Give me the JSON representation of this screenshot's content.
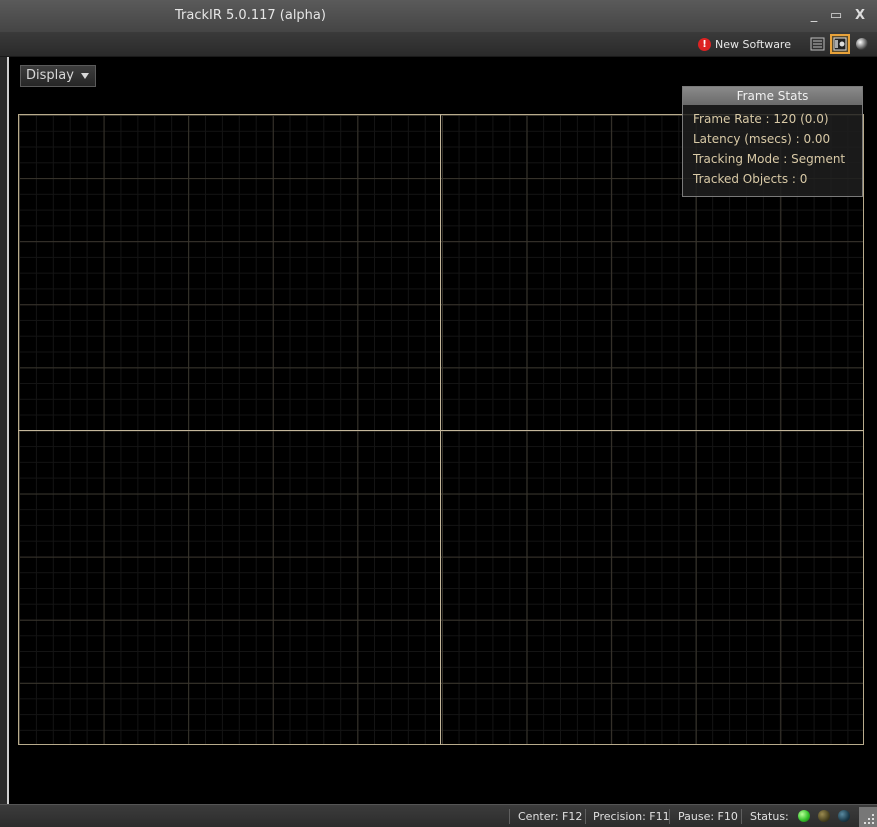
{
  "window": {
    "title": "TrackIR 5.0.117 (alpha)",
    "minimize_glyph": "_",
    "maximize_glyph": "▭",
    "close_glyph": "X"
  },
  "toolbar": {
    "new_software_label": "New Software",
    "alert_glyph": "!",
    "icons": [
      "list-view-icon",
      "camera-view-icon",
      "sphere-view-icon"
    ]
  },
  "display": {
    "label": "Display"
  },
  "frame_stats": {
    "title": "Frame Stats",
    "lines": [
      "Frame Rate : 120 (0.0)",
      "Latency (msecs) : 0.00",
      "Tracking Mode : Segment",
      "Tracked Objects : 0"
    ]
  },
  "status_bar": {
    "center": "Center: F12",
    "precision": "Precision: F11",
    "pause": "Pause: F10",
    "status": "Status:"
  },
  "colors": {
    "led_green": "#35c12a",
    "led_olive": "#4a4320",
    "led_teal": "#1b3b4a",
    "accent_orange": "#e8a23a",
    "grid_line": "#b8ab8c"
  }
}
